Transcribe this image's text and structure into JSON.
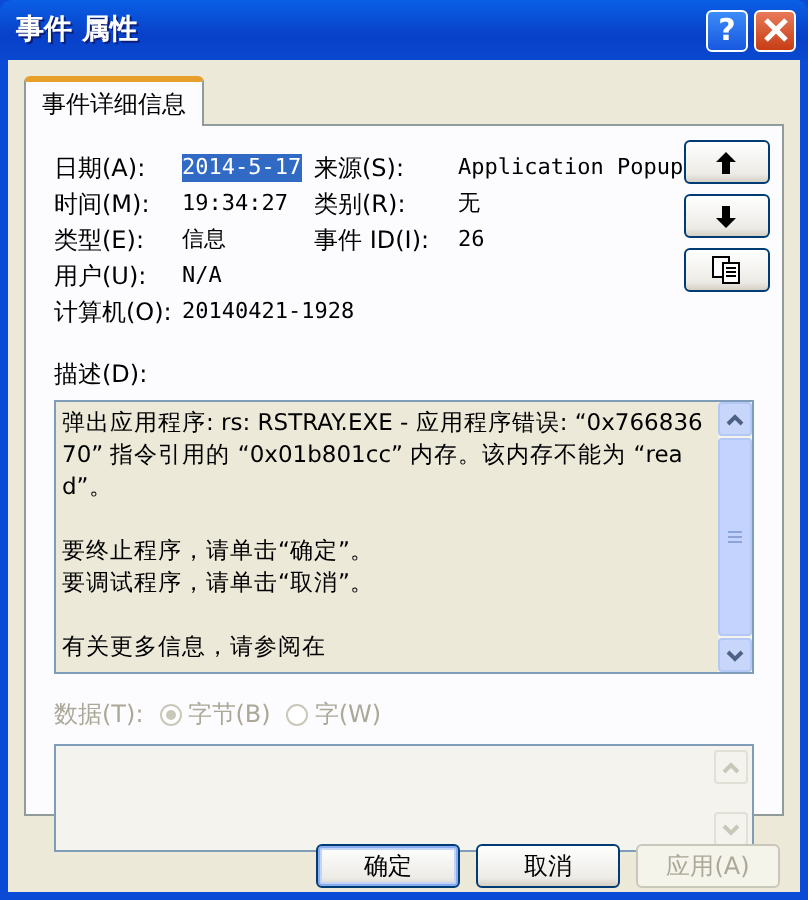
{
  "window": {
    "title": "事件 属性",
    "help_label": "?"
  },
  "tabs": [
    {
      "label": "事件详细信息",
      "selected": true
    }
  ],
  "fields": [
    {
      "label": "日期(A):",
      "value": "2014-5-17",
      "selected": true
    },
    {
      "label": "来源(S):",
      "value": "Application Popup",
      "selected": false
    },
    {
      "label": "时间(M):",
      "value": "19:34:27",
      "selected": false
    },
    {
      "label": "类别(R):",
      "value": "无",
      "selected": false
    },
    {
      "label": "类型(E):",
      "value": "信息",
      "selected": false
    },
    {
      "label": "事件 ID(I):",
      "value": "26",
      "selected": false
    },
    {
      "label": "用户(U):",
      "value": "N/A",
      "selected": false
    },
    {
      "label": "计算机(O):",
      "value": "20140421-1928",
      "selected": false
    }
  ],
  "nav_buttons": [
    {
      "kind": "up"
    },
    {
      "kind": "down"
    },
    {
      "kind": "copy"
    }
  ],
  "description": {
    "label": "描述(D):",
    "paragraphs": [
      [
        "弹出应用程序: rs: RSTRAY.EXE - 应用程序错误: “0x76683670” 指令引用的 “0x01b801cc” 内存。该内存不能为 “read”。"
      ],
      [
        "要终止程序，请单击“确定”。",
        "要调试程序，请单击“取消”。"
      ],
      [
        "有关更多信息，请参阅在"
      ]
    ]
  },
  "data": {
    "label": "数据(T):",
    "disabled": true,
    "options": [
      {
        "label": "字节(B)",
        "selected": true
      },
      {
        "label": "字(W)",
        "selected": false
      }
    ]
  },
  "buttons": [
    {
      "label": "确定",
      "default": true,
      "disabled": false
    },
    {
      "label": "取消",
      "default": false,
      "disabled": false
    },
    {
      "label": "应用(A)",
      "default": false,
      "disabled": true
    }
  ]
}
